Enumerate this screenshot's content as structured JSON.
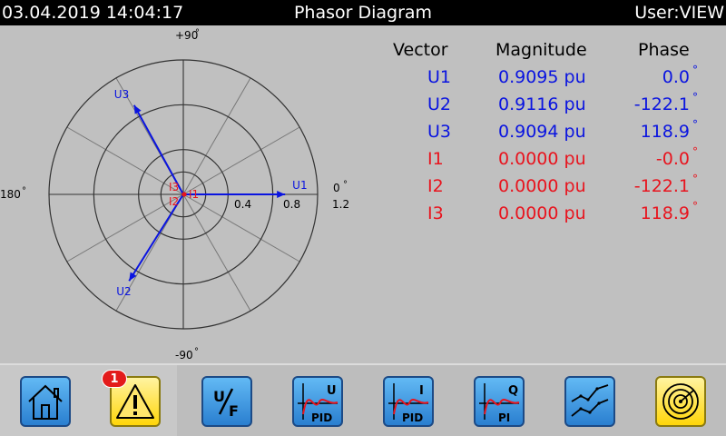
{
  "header": {
    "datetime": "03.04.2019 14:04:17",
    "title": "Phasor Diagram",
    "user": "User:VIEW"
  },
  "polar": {
    "label_top": "+90",
    "label_bottom": "-90",
    "label_left": "180",
    "label_right": "0",
    "ring_labels": [
      "0.4",
      "0.8",
      "1.2"
    ],
    "max_radius": 1.2
  },
  "table": {
    "headers": {
      "vector": "Vector",
      "magnitude": "Magnitude",
      "phase": "Phase"
    },
    "degree_symbol": "°",
    "rows": [
      {
        "vector": "U1",
        "magnitude": "0.9095 pu",
        "phase": "0.0",
        "mag_value": 0.9095,
        "angle": 0.0,
        "color": "#0a14e0"
      },
      {
        "vector": "U2",
        "magnitude": "0.9116 pu",
        "phase": "-122.1",
        "mag_value": 0.9116,
        "angle": -122.1,
        "color": "#0a14e0"
      },
      {
        "vector": "U3",
        "magnitude": "0.9094 pu",
        "phase": "118.9",
        "mag_value": 0.9094,
        "angle": 118.9,
        "color": "#0a14e0"
      },
      {
        "vector": "I1",
        "magnitude": "0.0000 pu",
        "phase": "-0.0",
        "mag_value": 0.0,
        "angle": 0.0,
        "color": "#e8141e"
      },
      {
        "vector": "I2",
        "magnitude": "0.0000 pu",
        "phase": "-122.1",
        "mag_value": 0.0,
        "angle": -122.1,
        "color": "#e8141e"
      },
      {
        "vector": "I3",
        "magnitude": "0.0000 pu",
        "phase": "118.9",
        "mag_value": 0.0,
        "angle": 118.9,
        "color": "#e8141e"
      }
    ]
  },
  "toolbar": {
    "alarm_count": "1",
    "buttons": [
      {
        "name": "home-button",
        "icon": "home-icon"
      },
      {
        "name": "alarm-button",
        "icon": "warning-icon"
      },
      {
        "name": "u-f-button",
        "icon": "u-over-f-icon",
        "top": "U",
        "bottom": "F"
      },
      {
        "name": "u-pid-button",
        "icon": "pid-u-icon",
        "top": "U",
        "bottom": "PID"
      },
      {
        "name": "i-pid-button",
        "icon": "pid-i-icon",
        "top": "I",
        "bottom": "PID"
      },
      {
        "name": "q-pi-button",
        "icon": "pi-q-icon",
        "top": "Q",
        "bottom": "PI"
      },
      {
        "name": "trend-button",
        "icon": "trend-chart-icon"
      },
      {
        "name": "phasor-button",
        "icon": "radar-target-icon"
      }
    ]
  }
}
